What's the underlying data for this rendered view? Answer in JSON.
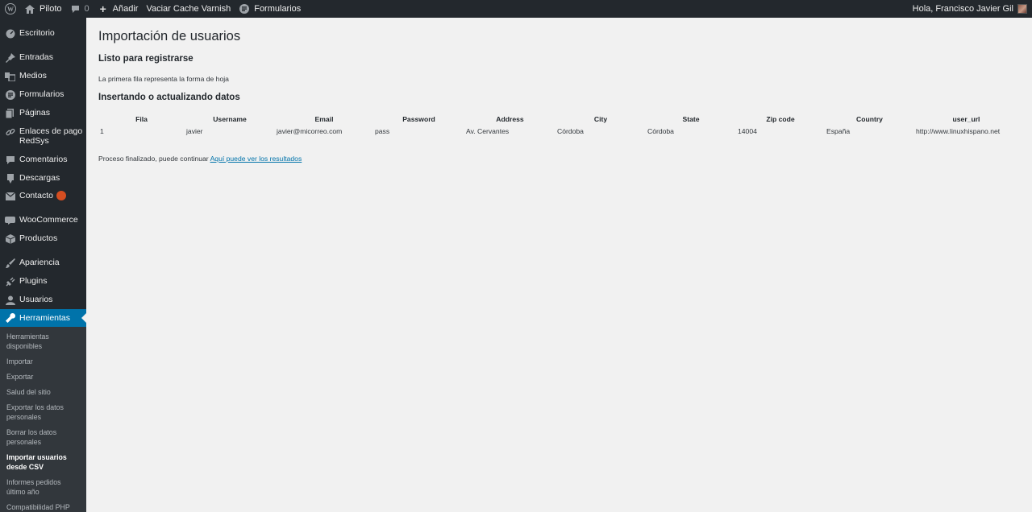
{
  "adminbar": {
    "site_name": "Piloto",
    "comments_count": "0",
    "add_label": "Añadir",
    "varnish_label": "Vaciar Cache Varnish",
    "forms_label": "Formularios",
    "greeting": "Hola, Francisco Javier Gil"
  },
  "sidebar": {
    "items": [
      {
        "label": "Escritorio",
        "icon": "dashboard-icon"
      },
      {
        "label": "Entradas",
        "icon": "pin-icon"
      },
      {
        "label": "Medios",
        "icon": "media-icon"
      },
      {
        "label": "Formularios",
        "icon": "forms-icon"
      },
      {
        "label": "Páginas",
        "icon": "pages-icon"
      },
      {
        "label": "Enlaces de pago RedSys",
        "icon": "link-icon"
      },
      {
        "label": "Comentarios",
        "icon": "comments-icon"
      },
      {
        "label": "Descargas",
        "icon": "download-icon"
      },
      {
        "label": "Contacto",
        "icon": "mail-icon"
      },
      {
        "label": "WooCommerce",
        "icon": "woocommerce-icon"
      },
      {
        "label": "Productos",
        "icon": "products-icon"
      },
      {
        "label": "Apariencia",
        "icon": "appearance-icon"
      },
      {
        "label": "Plugins",
        "icon": "plugins-icon"
      },
      {
        "label": "Usuarios",
        "icon": "users-icon"
      },
      {
        "label": "Herramientas",
        "icon": "wrench-icon"
      }
    ],
    "submenu": [
      "Herramientas disponibles",
      "Importar",
      "Exportar",
      "Salud del sitio",
      "Exportar los datos personales",
      "Borrar los datos personales",
      "Importar usuarios desde CSV",
      "Informes pedidos último año",
      "Compatibilidad PHP"
    ]
  },
  "main": {
    "title": "Importación de usuarios",
    "section1": "Listo para registrarse",
    "note": "La primera fila representa la forma de hoja",
    "section2": "Insertando o actualizando datos",
    "table": {
      "headers": [
        "Fila",
        "Username",
        "Email",
        "Password",
        "Address",
        "City",
        "State",
        "Zip code",
        "Country",
        "user_url"
      ],
      "rows": [
        [
          "1",
          "javier",
          "javier@micorreo.com",
          "pass",
          "Av. Cervantes",
          "Córdoba",
          "Córdoba",
          "14004",
          "España",
          "http://www.linuxhispano.net"
        ]
      ]
    },
    "finished_text": "Proceso finalizado, puede continuar",
    "results_link": "Aquí puede ver los resultados"
  }
}
